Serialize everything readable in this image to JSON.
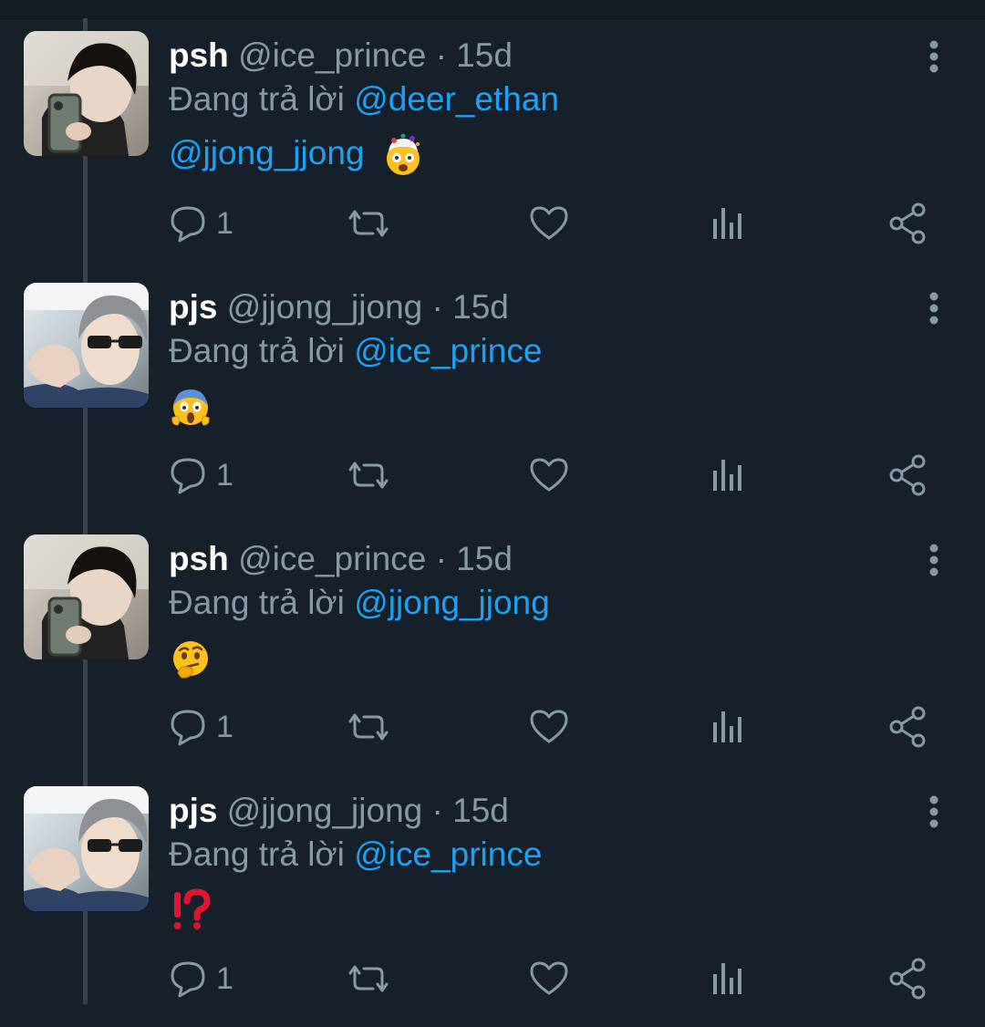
{
  "colors": {
    "background": "#15202b",
    "name": "#ffffff",
    "secondary": "#8899a6",
    "link": "#1da1f2",
    "thread_line": "#38444d"
  },
  "tweets": [
    {
      "name": "psh",
      "handle": "@ice_prince",
      "separator": "·",
      "time": "15d",
      "replying_prefix": "Đang trả lời",
      "replying_to": "@deer_ethan",
      "content_mention": "@jjong_jjong",
      "content_emoji": "exploding-head-emoji",
      "reply_count": "1",
      "avatar": "avatar-photo-psh"
    },
    {
      "name": "pjs",
      "handle": "@jjong_jjong",
      "separator": "·",
      "time": "15d",
      "replying_prefix": "Đang trả lời",
      "replying_to": "@ice_prince",
      "content_mention": "",
      "content_emoji": "screaming-face-emoji",
      "reply_count": "1",
      "avatar": "avatar-photo-pjs"
    },
    {
      "name": "psh",
      "handle": "@ice_prince",
      "separator": "·",
      "time": "15d",
      "replying_prefix": "Đang trả lời",
      "replying_to": "@jjong_jjong",
      "content_mention": "",
      "content_emoji": "thinking-face-emoji",
      "reply_count": "1",
      "avatar": "avatar-photo-psh"
    },
    {
      "name": "pjs",
      "handle": "@jjong_jjong",
      "separator": "·",
      "time": "15d",
      "replying_prefix": "Đang trả lời",
      "replying_to": "@ice_prince",
      "content_mention": "",
      "content_emoji": "interrobang-emoji",
      "reply_count": "1",
      "avatar": "avatar-photo-pjs"
    }
  ],
  "icons": {
    "reply": "reply-icon",
    "retweet": "retweet-icon",
    "like": "heart-icon",
    "analytics": "analytics-icon",
    "share": "share-icon",
    "more": "more-vertical-icon"
  }
}
